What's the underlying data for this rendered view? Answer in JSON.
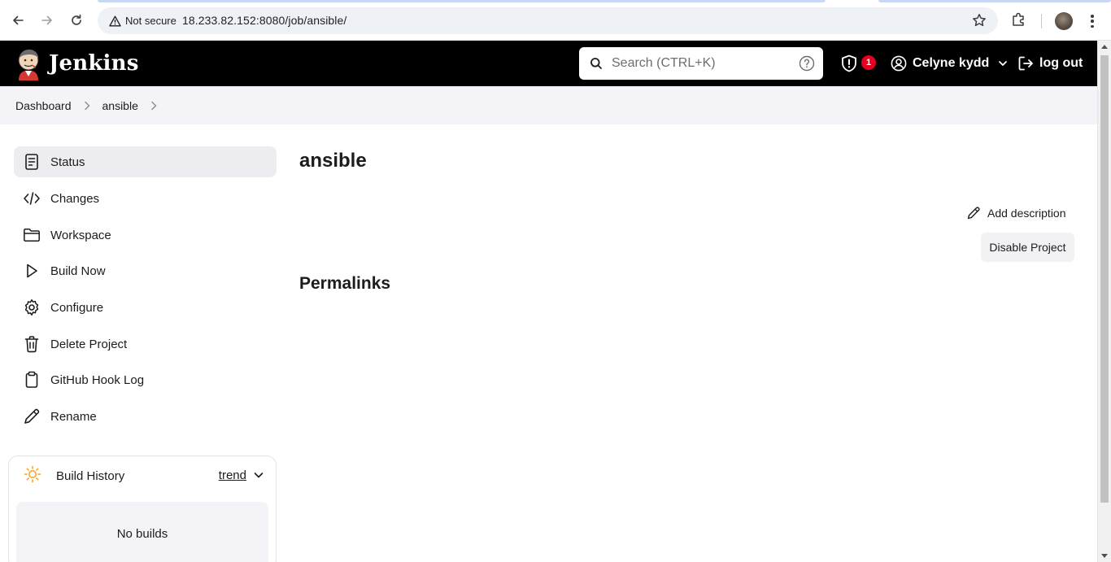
{
  "browser": {
    "security_label": "Not secure",
    "url": "18.233.82.152:8080/job/ansible/"
  },
  "header": {
    "brand": "Jenkins",
    "search_placeholder": "Search (CTRL+K)",
    "security_badge_count": "1",
    "user_name": "Celyne kydd",
    "logout_label": "log out"
  },
  "breadcrumb": {
    "items": [
      "Dashboard",
      "ansible"
    ]
  },
  "sidebar": {
    "items": [
      {
        "label": "Status",
        "icon": "status-icon",
        "active": true
      },
      {
        "label": "Changes",
        "icon": "code-icon"
      },
      {
        "label": "Workspace",
        "icon": "folder-icon"
      },
      {
        "label": "Build Now",
        "icon": "play-icon"
      },
      {
        "label": "Configure",
        "icon": "gear-icon"
      },
      {
        "label": "Delete Project",
        "icon": "trash-icon"
      },
      {
        "label": "GitHub Hook Log",
        "icon": "clipboard-icon"
      },
      {
        "label": "Rename",
        "icon": "pencil-icon"
      }
    ]
  },
  "build_history": {
    "title": "Build History",
    "trend_label": "trend",
    "empty_text": "No builds"
  },
  "main": {
    "title": "ansible",
    "add_description_label": "Add description",
    "disable_button_label": "Disable Project",
    "permalinks_heading": "Permalinks"
  },
  "colors": {
    "header_bg": "#000000",
    "badge_red": "#e6001f",
    "breadcrumb_bg": "#f4f4f8",
    "active_item_bg": "#ececf1",
    "sun_yellow": "#f5a623"
  }
}
